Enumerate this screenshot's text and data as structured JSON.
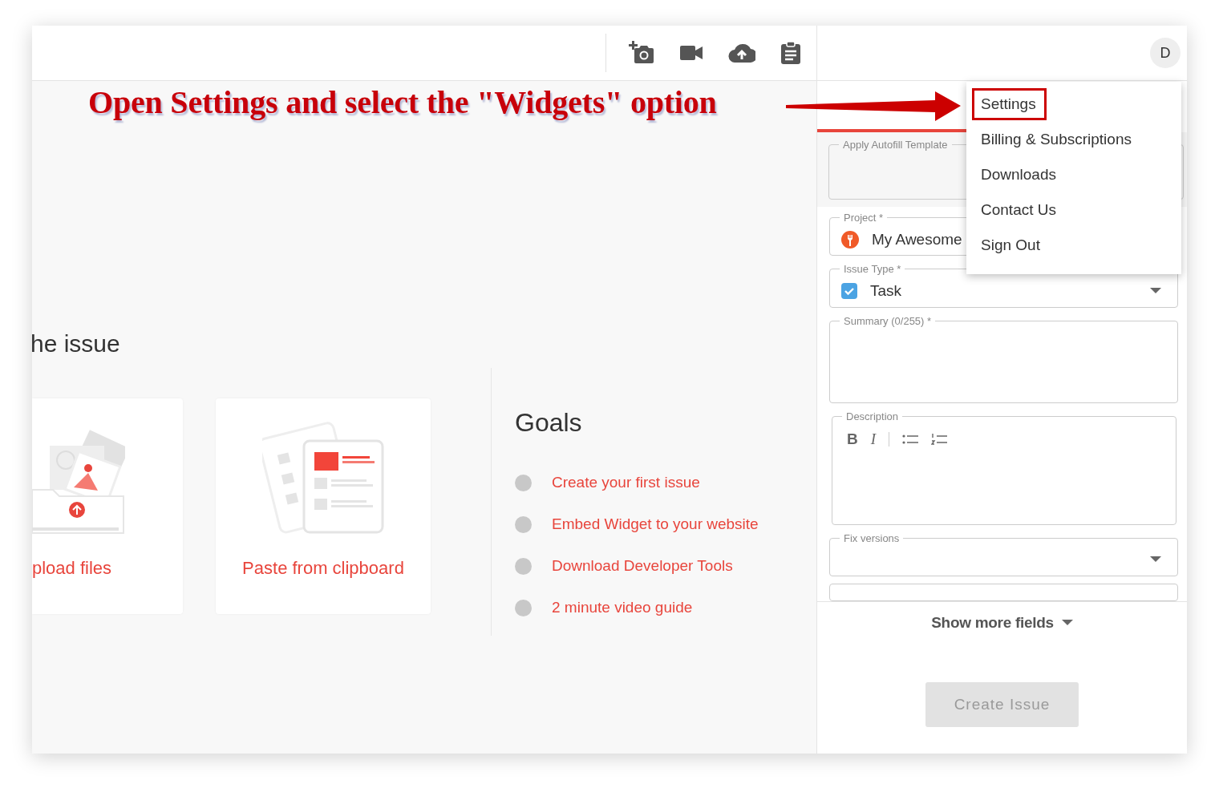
{
  "annotation": {
    "text": "Open Settings and select the \"Widgets\" option"
  },
  "main": {
    "heading": "he issue",
    "cards": [
      {
        "kind": "upload",
        "label": "pload files"
      },
      {
        "kind": "clipboard",
        "label": "Paste from clipboard"
      }
    ],
    "goals": {
      "title": "Goals",
      "items": [
        "Create your first issue",
        "Embed Widget to your website",
        "Download Developer Tools",
        "2 minute video guide"
      ]
    }
  },
  "panel": {
    "avatar": "D",
    "autofill": {
      "label": "Apply Autofill Template"
    },
    "fields": [
      {
        "kind": "select",
        "label": "Project *",
        "value": "My Awesome"
      },
      {
        "kind": "select",
        "label": "Issue Type *",
        "value": "Task"
      },
      {
        "kind": "text",
        "label": "Summary (0/255) *"
      },
      {
        "kind": "editor",
        "label": "Description",
        "tools": [
          "B",
          "I"
        ]
      },
      {
        "kind": "select",
        "label": "Fix versions"
      }
    ],
    "show_more": "Show more fields",
    "create_button": {
      "label": "Create Issue",
      "disabled": true
    }
  },
  "menu": {
    "items": [
      {
        "label": "Settings",
        "highlighted": true
      },
      {
        "label": "Billing & Subscriptions",
        "highlighted": false
      },
      {
        "label": "Downloads",
        "highlighted": false
      },
      {
        "label": "Contact Us",
        "highlighted": false
      },
      {
        "label": "Sign Out",
        "highlighted": false
      }
    ]
  }
}
